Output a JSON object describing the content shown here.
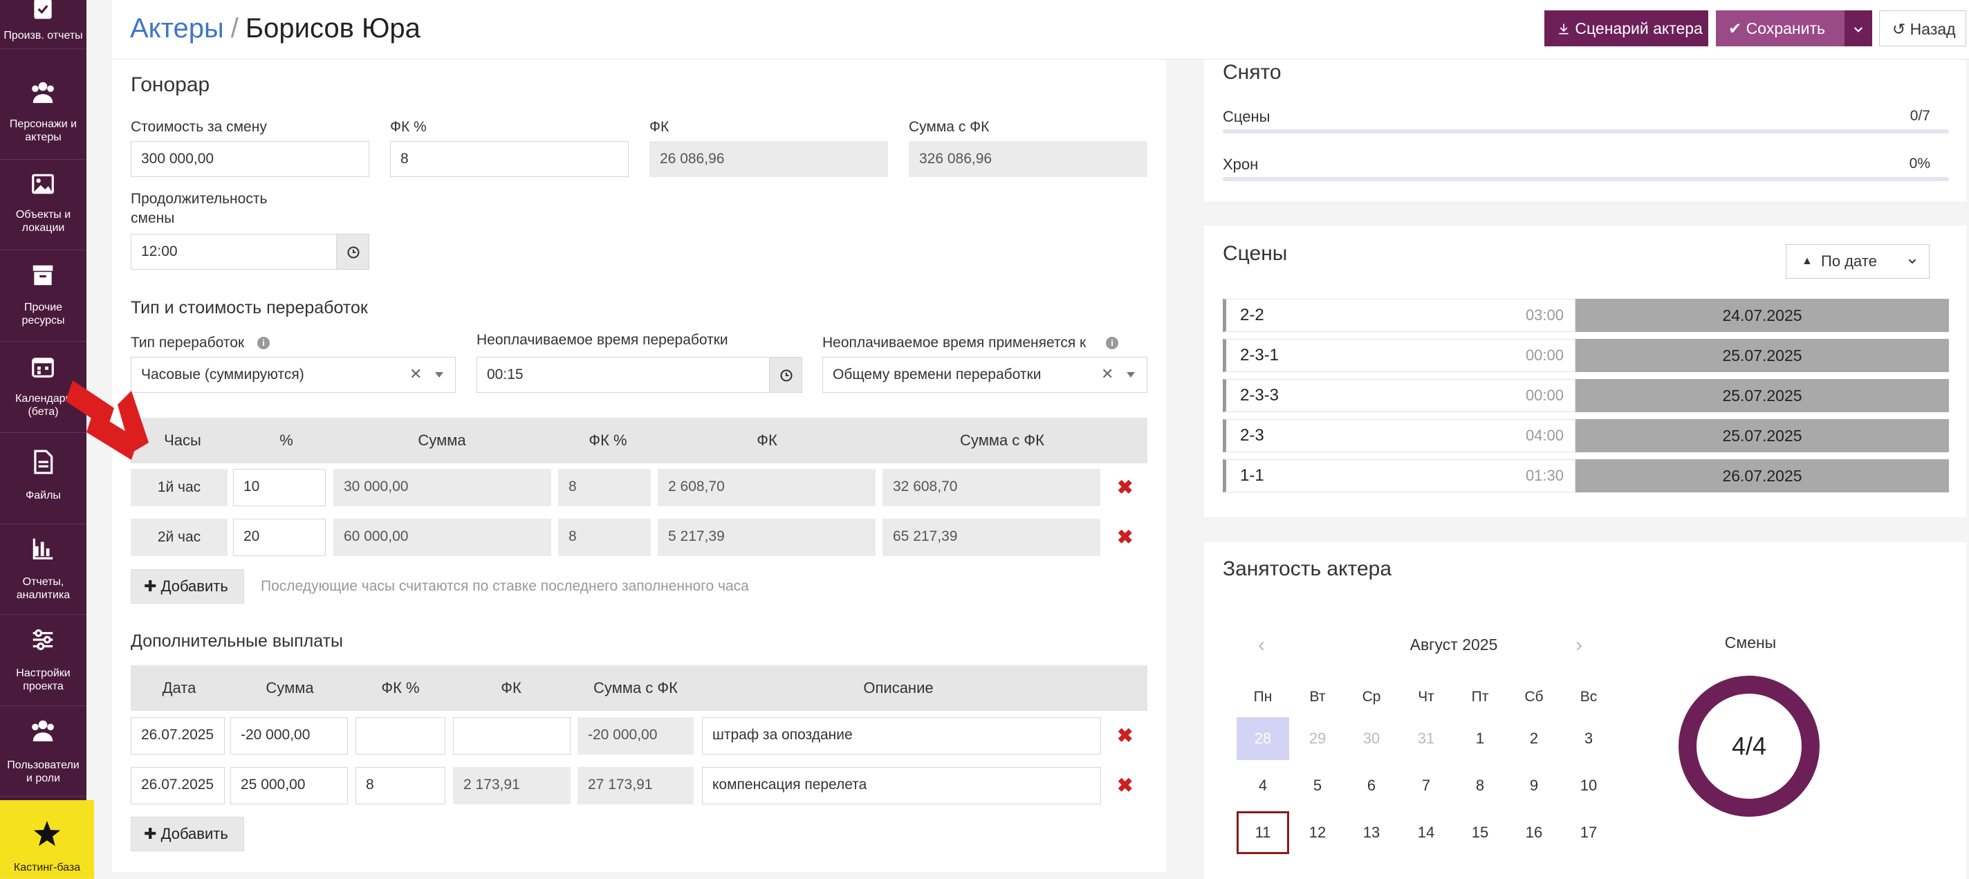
{
  "sidebar": {
    "items": [
      {
        "label": "Произв. отчеты",
        "icon": "report-icon"
      },
      {
        "label": "Персонажи и актеры",
        "icon": "users-icon"
      },
      {
        "label": "Объекты и локации",
        "icon": "image-icon"
      },
      {
        "label": "Прочие ресурсы",
        "icon": "archive-icon"
      },
      {
        "label": "Календарь (бета)",
        "icon": "calendar-icon"
      },
      {
        "label": "Файлы",
        "icon": "file-icon"
      },
      {
        "label": "Отчеты, аналитика",
        "icon": "chart-icon"
      },
      {
        "label": "Настройки проекта",
        "icon": "sliders-icon"
      },
      {
        "label": "Пользователи и роли",
        "icon": "users-icon"
      },
      {
        "label": "Кастинг-база",
        "icon": "star-icon"
      }
    ]
  },
  "header": {
    "breadcrumb_link": "Актеры",
    "separator": "/",
    "current": "Борисов Юра",
    "script_button": "Сценарий актера",
    "save_button": "Сохранить",
    "back_button": "Назад"
  },
  "fee": {
    "title": "Гонорар",
    "shift_cost_label": "Стоимость за смену",
    "shift_cost_value": "300 000,00",
    "fk_pct_label": "ФК %",
    "fk_pct_value": "8",
    "fk_label": "ФК",
    "fk_value": "26 086,96",
    "sum_fk_label": "Сумма с ФК",
    "sum_fk_value": "326 086,96",
    "duration_label": "Продолжительность смены",
    "duration_value": "12:00"
  },
  "overtime": {
    "title": "Тип и стоимость переработок",
    "type_label": "Тип переработок",
    "type_value": "Часовые (суммируются)",
    "unpaid_label": "Неоплачиваемое время переработки",
    "unpaid_value": "00:15",
    "applies_label": "Неоплачиваемое время применяется к",
    "applies_value": "Общему времени переработки",
    "columns": [
      "Часы",
      "%",
      "Сумма",
      "ФК %",
      "ФК",
      "Сумма с ФК"
    ],
    "rows": [
      {
        "hour": "1й час",
        "pct": "10",
        "sum": "30 000,00",
        "fk_pct": "8",
        "fk": "2 608,70",
        "sum_fk": "32 608,70"
      },
      {
        "hour": "2й час",
        "pct": "20",
        "sum": "60 000,00",
        "fk_pct": "8",
        "fk": "5 217,39",
        "sum_fk": "65 217,39"
      }
    ],
    "add_button": "Добавить",
    "hint": "Последующие часы считаются по ставке последнего заполненного часа"
  },
  "extra": {
    "title": "Дополнительные выплаты",
    "columns": [
      "Дата",
      "Сумма",
      "ФК %",
      "ФК",
      "Сумма с ФК",
      "Описание"
    ],
    "rows": [
      {
        "date": "26.07.2025",
        "sum": "-20 000,00",
        "fk_pct": "",
        "fk": "",
        "sum_fk": "-20 000,00",
        "desc": "штраф за опоздание"
      },
      {
        "date": "26.07.2025",
        "sum": "25 000,00",
        "fk_pct": "8",
        "fk": "2 173,91",
        "sum_fk": "27 173,91",
        "desc": "компенсация перелета"
      }
    ],
    "add_button": "Добавить"
  },
  "shot": {
    "title": "Снято",
    "scenes_label": "Сцены",
    "scenes_value": "0/7",
    "chron_label": "Хрон",
    "chron_value": "0%"
  },
  "scenes": {
    "title": "Сцены",
    "sort_label": "По дате",
    "items": [
      {
        "name": "2-2",
        "dur": "03:00",
        "date": "24.07.2025"
      },
      {
        "name": "2-3-1",
        "dur": "00:00",
        "date": "25.07.2025"
      },
      {
        "name": "2-3-3",
        "dur": "00:00",
        "date": "25.07.2025"
      },
      {
        "name": "2-3",
        "dur": "04:00",
        "date": "25.07.2025"
      },
      {
        "name": "1-1",
        "dur": "01:30",
        "date": "26.07.2025"
      }
    ]
  },
  "busy": {
    "title": "Занятость актера",
    "month": "Август 2025",
    "dow": [
      "Пн",
      "Вт",
      "Ср",
      "Чт",
      "Пт",
      "Сб",
      "Вс"
    ],
    "week1": [
      "28",
      "29",
      "30",
      "31",
      "1",
      "2",
      "3"
    ],
    "week2": [
      "4",
      "5",
      "6",
      "7",
      "8",
      "9",
      "10"
    ],
    "week3": [
      "11",
      "12",
      "13",
      "14",
      "15",
      "16",
      "17"
    ],
    "shifts_title": "Смены",
    "shifts_value": "4/4"
  },
  "colors": {
    "sidebar": "#4a1a3c",
    "accent": "#6d2058",
    "link": "#3f77c8",
    "danger": "#cc1f1f",
    "casting": "#f5e11e"
  }
}
